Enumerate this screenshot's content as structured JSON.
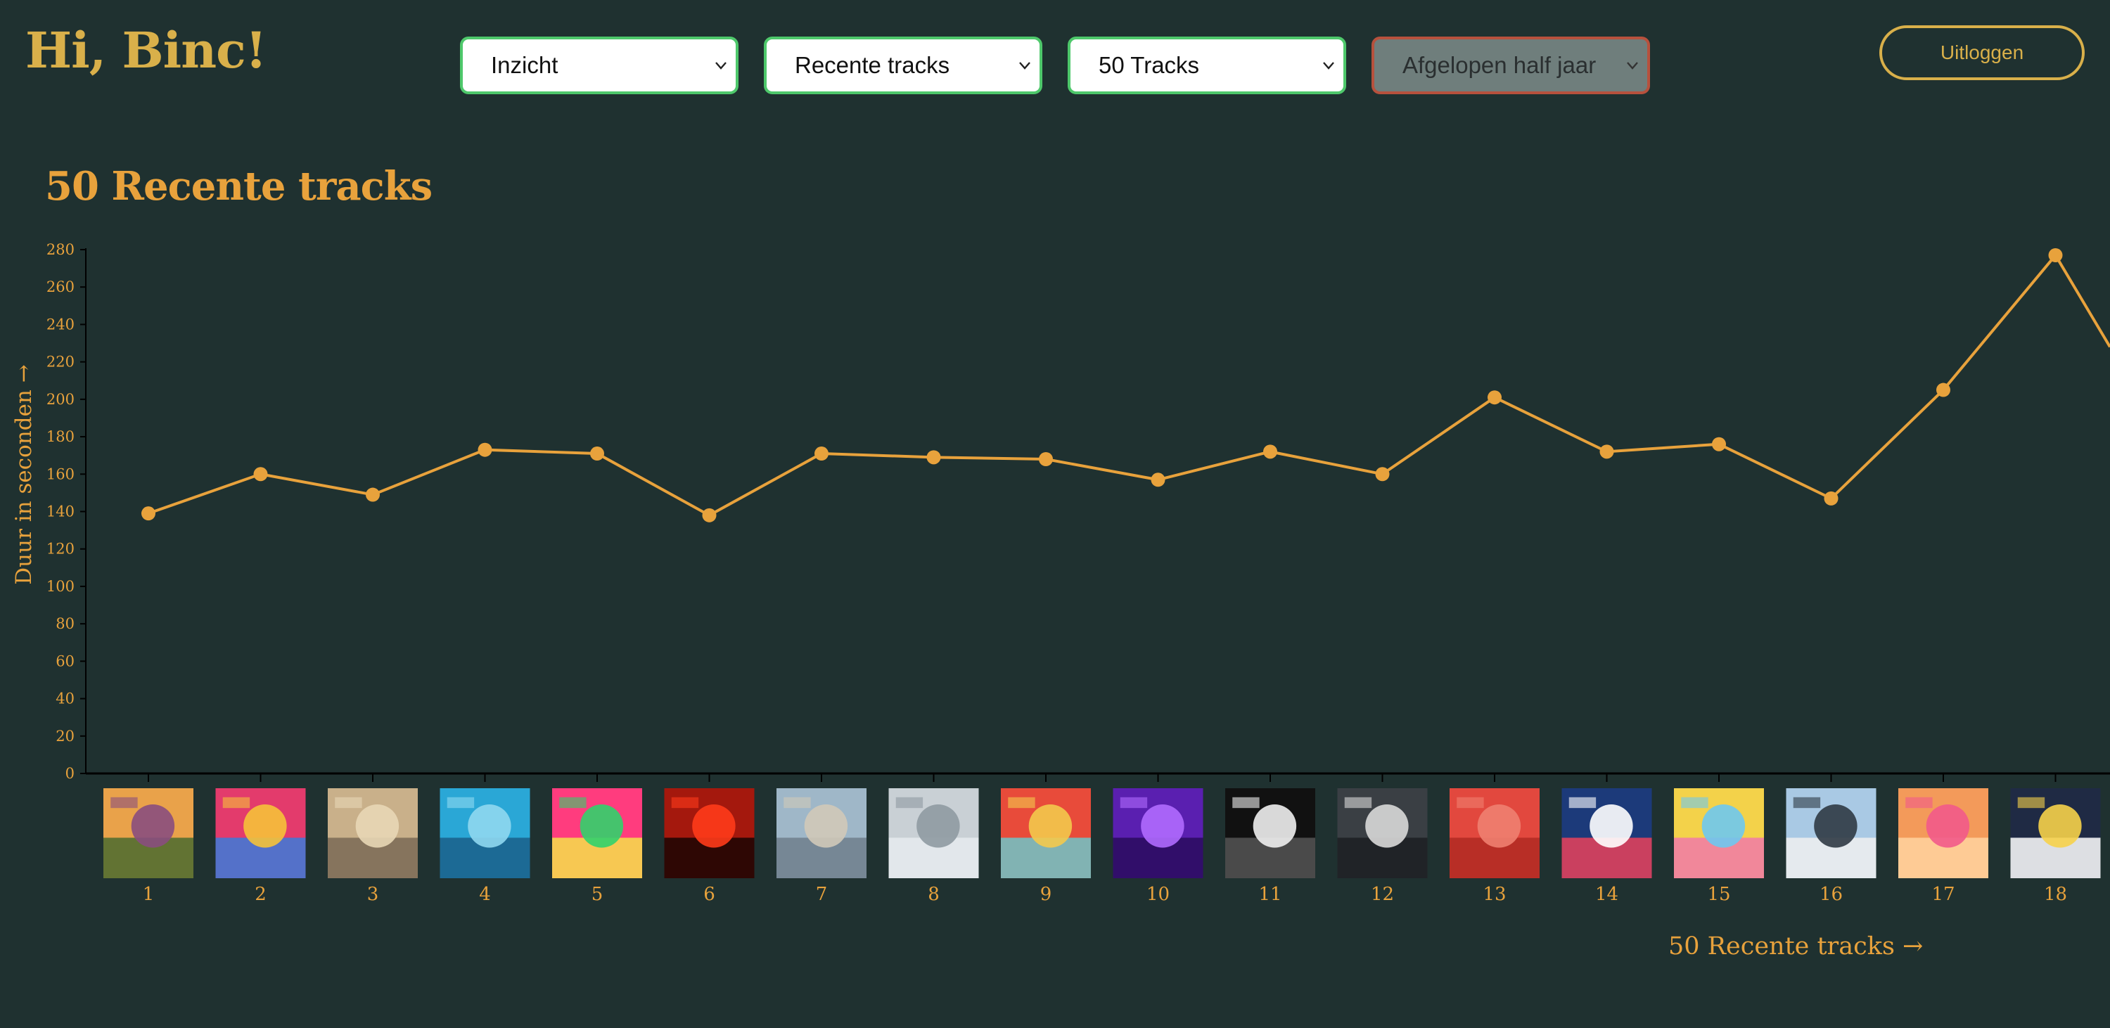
{
  "header": {
    "greeting": "Hi, Binc!",
    "selects": [
      {
        "value": "Inzicht",
        "enabled": true
      },
      {
        "value": "Recente tracks",
        "enabled": true
      },
      {
        "value": "50 Tracks",
        "enabled": true
      },
      {
        "value": "Afgelopen half jaar",
        "enabled": false
      }
    ],
    "logout_label": "Uitloggen"
  },
  "colors": {
    "background": "#1f3130",
    "accent": "#e8a23c",
    "greeting": "#d9b04a",
    "select_border": "#4ec86b",
    "disabled_border": "#b7513d"
  },
  "chart_data": {
    "type": "line",
    "title": "50 Recente tracks",
    "ylabel": "Duur in seconden →",
    "xlabel": "50 Recente tracks →",
    "ylim": [
      0,
      280
    ],
    "yticks": [
      0,
      20,
      40,
      60,
      80,
      100,
      120,
      140,
      160,
      180,
      200,
      220,
      240,
      260,
      280
    ],
    "x": [
      1,
      2,
      3,
      4,
      5,
      6,
      7,
      8,
      9,
      10,
      11,
      12,
      13,
      14,
      15,
      16,
      17,
      18
    ],
    "values": [
      139,
      160,
      149,
      173,
      171,
      138,
      171,
      169,
      168,
      157,
      172,
      160,
      201,
      172,
      176,
      147,
      205,
      277
    ],
    "continues_beyond_view": true,
    "point_images": [
      {
        "x": 1,
        "art": "flowers-landscape",
        "colors": [
          "#e9a24a",
          "#8a4e7e",
          "#4a6b2f"
        ]
      },
      {
        "x": 2,
        "art": "abstract-shapes",
        "colors": [
          "#e33b6c",
          "#f5c23a",
          "#3b7bd9"
        ]
      },
      {
        "x": 3,
        "art": "photo-car",
        "colors": [
          "#c9b08a",
          "#e8d7b5",
          "#7a6a55"
        ]
      },
      {
        "x": 4,
        "art": "pool-water",
        "colors": [
          "#2aa7d6",
          "#8fd8f0",
          "#1a5f8a"
        ]
      },
      {
        "x": 5,
        "art": "neon-figures",
        "colors": [
          "#ff3c7e",
          "#31d16b",
          "#f6e04a"
        ]
      },
      {
        "x": 6,
        "art": "red-halo",
        "colors": [
          "#a4180d",
          "#ff3b1a",
          "#1a0503"
        ]
      },
      {
        "x": 7,
        "art": "two-people",
        "colors": [
          "#9fb7c8",
          "#d0c9b8",
          "#6f7f8c"
        ]
      },
      {
        "x": 8,
        "art": "grey-photo",
        "colors": [
          "#c9d0d5",
          "#8f9aa2",
          "#e6ebef"
        ]
      },
      {
        "x": 9,
        "art": "pop-art-face",
        "colors": [
          "#e84b3a",
          "#f3c94d",
          "#6fc6c9"
        ]
      },
      {
        "x": 10,
        "art": "purple-lightning",
        "colors": [
          "#5a1fb0",
          "#b06aff",
          "#2a0c5e"
        ]
      },
      {
        "x": 11,
        "art": "bw-logo",
        "colors": [
          "#111111",
          "#f0f0f0",
          "#555555"
        ]
      },
      {
        "x": 12,
        "art": "band-photo",
        "colors": [
          "#3a3f44",
          "#d9d9d9",
          "#1c1f22"
        ]
      },
      {
        "x": 13,
        "art": "red-figure",
        "colors": [
          "#e2483e",
          "#f08070",
          "#b02a22"
        ]
      },
      {
        "x": 14,
        "art": "spinnin-logo",
        "colors": [
          "#1c3a7a",
          "#ffffff",
          "#e9425a"
        ]
      },
      {
        "x": 15,
        "art": "cartoon-collage",
        "colors": [
          "#f3d24a",
          "#6ec8f0",
          "#f07aa8"
        ]
      },
      {
        "x": 16,
        "art": "two-people-blue",
        "colors": [
          "#a9c9e4",
          "#2f3a44",
          "#f0f0f0"
        ]
      },
      {
        "x": 17,
        "art": "orange-pink",
        "colors": [
          "#f39a5a",
          "#f25a8a",
          "#ffd3a0"
        ]
      },
      {
        "x": 18,
        "art": "comic-face",
        "colors": [
          "#1f2a44",
          "#f6d24a",
          "#ffffff"
        ]
      }
    ]
  }
}
